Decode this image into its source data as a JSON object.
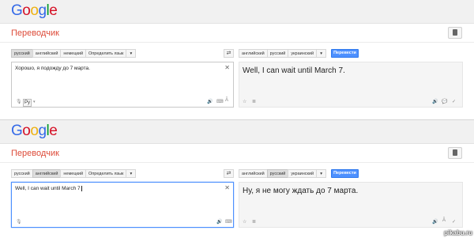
{
  "colors": {
    "accent": "#dd4b39",
    "button": "#4d90fe"
  },
  "panels": [
    {
      "title": "Переводчик",
      "source_tabs": [
        "русский",
        "английский",
        "немецкий",
        "Определить язык"
      ],
      "source_active": 0,
      "target_tabs": [
        "английский",
        "русский",
        "украинский"
      ],
      "target_active": -1,
      "translate_label": "Перевести",
      "source_text": "Хорошо, я подожду до 7 марта.",
      "result_text": "Well, I can wait until March 7.",
      "keyboard_label": "Ру"
    },
    {
      "title": "Переводчик",
      "source_tabs": [
        "русский",
        "английский",
        "немецкий",
        "Определить язык"
      ],
      "source_active": 1,
      "target_tabs": [
        "английский",
        "русский",
        "украинский"
      ],
      "target_active": 1,
      "translate_label": "Перевести",
      "source_text": "Well, I can wait until March 7",
      "result_text": "Ну, я не могу ждать до 7 марта."
    }
  ],
  "logo_letters": [
    "G",
    "o",
    "o",
    "g",
    "l",
    "e"
  ],
  "watermark": "pikabu.ru"
}
